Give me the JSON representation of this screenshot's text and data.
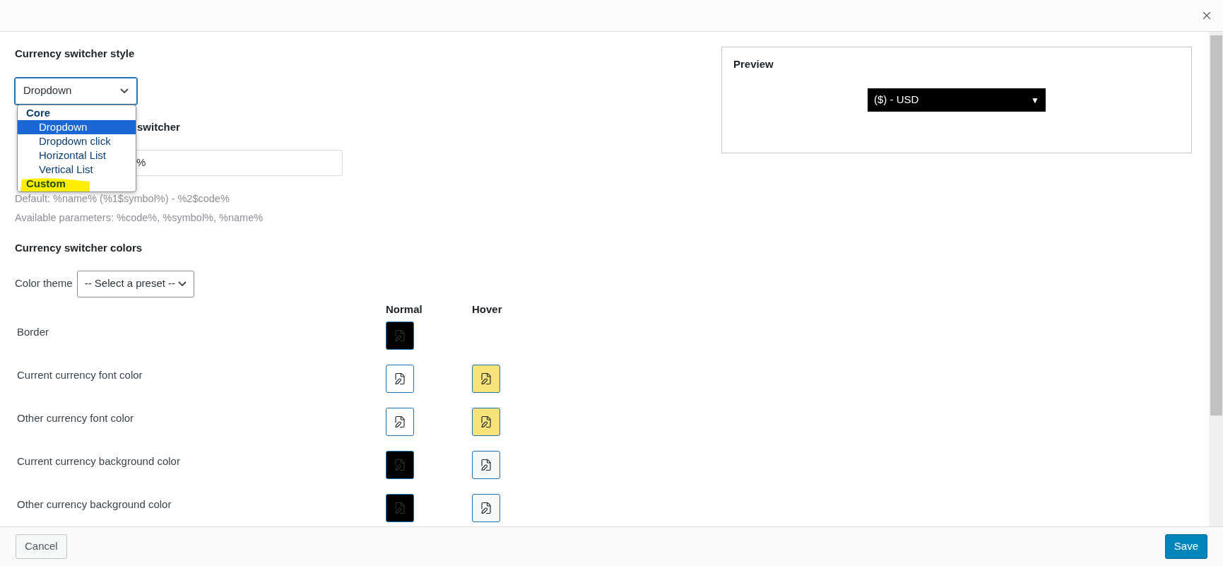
{
  "style_section": {
    "heading": "Currency switcher style",
    "select_value": "Dropdown",
    "options": [
      {
        "kind": "group",
        "label": "Core",
        "highlighted": false
      },
      {
        "kind": "option",
        "label": "Dropdown",
        "selected": true
      },
      {
        "kind": "option",
        "label": "Dropdown click",
        "selected": false
      },
      {
        "kind": "option",
        "label": "Horizontal List",
        "selected": false
      },
      {
        "kind": "option",
        "label": "Vertical List",
        "selected": false
      },
      {
        "kind": "group",
        "label": "Custom",
        "highlighted": true
      }
    ]
  },
  "template_section": {
    "heading_visible": "switcher",
    "input_visible": "%",
    "help": [
      "Default: %name% (%1$symbol%) - %2$code%",
      "Available parameters: %code%, %symbol%, %name%"
    ]
  },
  "colors_section": {
    "heading": "Currency switcher colors",
    "theme_label": "Color theme",
    "theme_select": "-- Select a preset --",
    "columns": [
      "Normal",
      "Hover"
    ],
    "rows": [
      {
        "label": "Border",
        "normal": {
          "color": "#000000"
        }
      },
      {
        "label": "Current currency font color",
        "normal": {
          "color": "#ffffff"
        },
        "hover": {
          "color": "#f8e27a"
        }
      },
      {
        "label": "Other currency font color",
        "normal": {
          "color": "#ffffff"
        },
        "hover": {
          "color": "#f8e27a"
        }
      },
      {
        "label": "Current currency background color",
        "normal": {
          "color": "#000000"
        },
        "hover": {
          "color": "#f6f7f7"
        }
      },
      {
        "label": "Other currency background color",
        "normal": {
          "color": "#000000"
        },
        "hover": {
          "color": "#f6f7f7"
        }
      }
    ]
  },
  "preview": {
    "title": "Preview",
    "switcher_value": "($) - USD",
    "arrow": "▼"
  },
  "footer": {
    "cancel": "Cancel",
    "save": "Save"
  }
}
